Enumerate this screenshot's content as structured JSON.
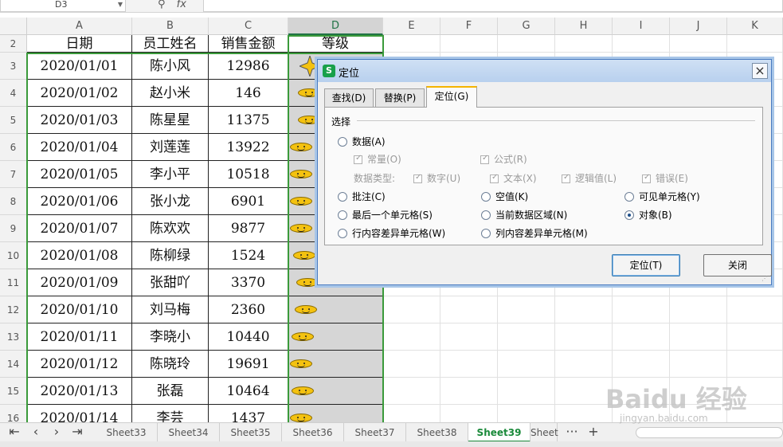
{
  "formula_bar": {
    "name_box": "D3",
    "fx": "fx"
  },
  "columns": [
    "A",
    "B",
    "C",
    "D",
    "E",
    "F",
    "G",
    "H",
    "I",
    "J",
    "K"
  ],
  "rows": [
    {
      "num": "2",
      "date": "日期",
      "name": "员工姓名",
      "amount": "销售金额",
      "level": "等级"
    },
    {
      "num": "3",
      "date": "2020/01/01",
      "name": "陈小风",
      "amount": "12986"
    },
    {
      "num": "4",
      "date": "2020/01/02",
      "name": "赵小米",
      "amount": "146"
    },
    {
      "num": "5",
      "date": "2020/01/03",
      "name": "陈星星",
      "amount": "11375"
    },
    {
      "num": "6",
      "date": "2020/01/04",
      "name": "刘莲莲",
      "amount": "13922"
    },
    {
      "num": "7",
      "date": "2020/01/05",
      "name": "李小平",
      "amount": "10518"
    },
    {
      "num": "8",
      "date": "2020/01/06",
      "name": "张小龙",
      "amount": "6901"
    },
    {
      "num": "9",
      "date": "2020/01/07",
      "name": "陈欢欢",
      "amount": "9877"
    },
    {
      "num": "10",
      "date": "2020/01/08",
      "name": "陈柳绿",
      "amount": "1524"
    },
    {
      "num": "11",
      "date": "2020/01/09",
      "name": "张甜吖",
      "amount": "3370"
    },
    {
      "num": "12",
      "date": "2020/01/10",
      "name": "刘马梅",
      "amount": "2360"
    },
    {
      "num": "13",
      "date": "2020/01/11",
      "name": "李晓小",
      "amount": "10440"
    },
    {
      "num": "14",
      "date": "2020/01/12",
      "name": "陈晓玲",
      "amount": "19691"
    },
    {
      "num": "15",
      "date": "2020/01/13",
      "name": "张磊",
      "amount": "10464"
    },
    {
      "num": "16",
      "date": "2020/01/14",
      "name": "李芸",
      "amount": "1437"
    }
  ],
  "sheet_tabs": [
    "Sheet33",
    "Sheet34",
    "Sheet35",
    "Sheet36",
    "Sheet37",
    "Sheet38",
    "Sheet39",
    "Sheet"
  ],
  "active_sheet": "Sheet39",
  "sheet_more": "···",
  "sheet_add": "+",
  "nav_buttons": {
    "first": "|<",
    "prev": "<",
    "next": ">",
    "last": ">|"
  },
  "dialog": {
    "title": "定位",
    "logo": "S",
    "close": "×",
    "tabs": [
      "查找(D)",
      "替换(P)",
      "定位(G)"
    ],
    "active_tab": "定位(G)",
    "group_label": "选择",
    "options": {
      "data": "数据(A)",
      "constant": "常量(O)",
      "formula": "公式(R)",
      "data_type_label": "数据类型:",
      "number": "数字(U)",
      "text": "文本(X)",
      "logical": "逻辑值(L)",
      "error": "错误(E)",
      "comment": "批注(C)",
      "blank": "空值(K)",
      "visible_cells": "可见单元格(Y)",
      "last_cell": "最后一个单元格(S)",
      "current_region": "当前数据区域(N)",
      "objects": "对象(B)",
      "row_diff": "行内容差异单元格(W)",
      "col_diff": "列内容差异单元格(M)"
    },
    "selected_option": "objects",
    "buttons": {
      "goto": "定位(T)",
      "close": "关闭"
    }
  },
  "watermark": {
    "logo": "Baidu 经验",
    "url": "jingyan.baidu.com"
  }
}
